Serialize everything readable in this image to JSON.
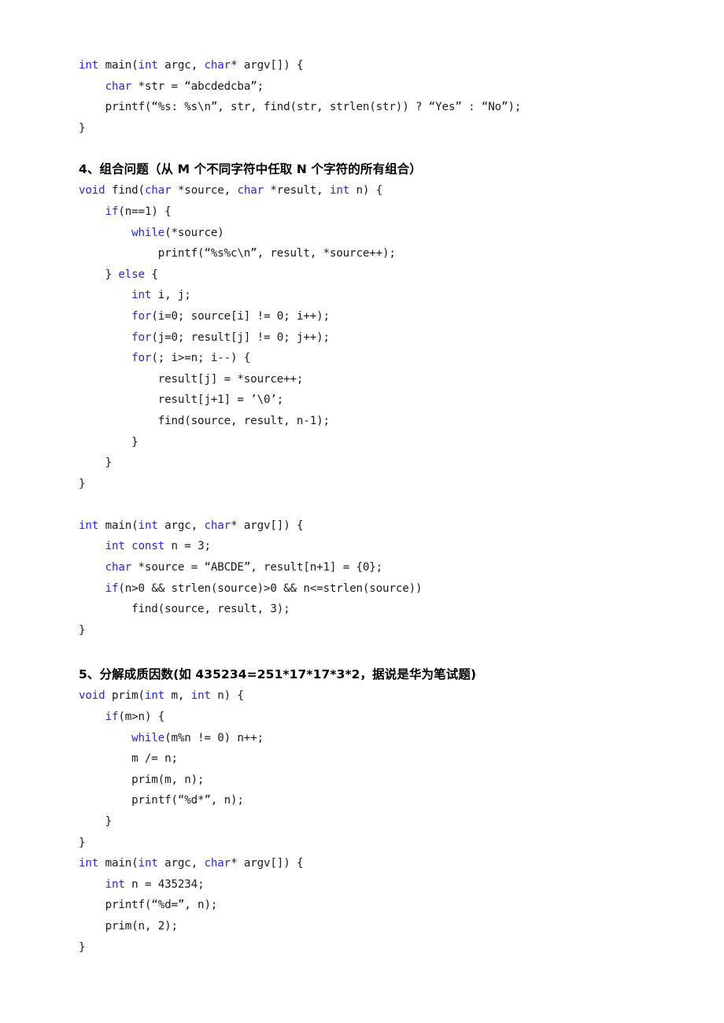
{
  "document": {
    "language": "zh-CN",
    "colors": {
      "page_background": "#ffffff",
      "body_text": "#1a1a1a",
      "keyword_blue": "#2a2ac4",
      "heading_text": "#000000"
    },
    "sections": [
      {
        "id": "section-3-tail",
        "heading": null,
        "code_lines": [
          [
            {
              "t": "int",
              "c": "kw"
            },
            {
              "t": " main(",
              "c": "plain"
            },
            {
              "t": "int",
              "c": "kw"
            },
            {
              "t": " argc, ",
              "c": "plain"
            },
            {
              "t": "char",
              "c": "kw"
            },
            {
              "t": "* argv[]) {",
              "c": "plain"
            }
          ],
          [
            {
              "t": "    ",
              "c": "plain"
            },
            {
              "t": "char",
              "c": "kw"
            },
            {
              "t": " *str = “abcdedcba”;",
              "c": "plain"
            }
          ],
          [
            {
              "t": "    printf(“%s: %s\\n”, str, find(str, strlen(str)) ? “Yes” : “No”);",
              "c": "plain"
            }
          ],
          [
            {
              "t": "}",
              "c": "plain"
            }
          ]
        ]
      },
      {
        "id": "section-4",
        "heading": "4、组合问题（从 M 个不同字符中任取 N 个字符的所有组合）",
        "code_lines": [
          [
            {
              "t": "void",
              "c": "kw"
            },
            {
              "t": " find(",
              "c": "plain"
            },
            {
              "t": "char",
              "c": "kw"
            },
            {
              "t": " *source, ",
              "c": "plain"
            },
            {
              "t": "char",
              "c": "kw"
            },
            {
              "t": " *result, ",
              "c": "plain"
            },
            {
              "t": "int",
              "c": "kw"
            },
            {
              "t": " n) {",
              "c": "plain"
            }
          ],
          [
            {
              "t": "    ",
              "c": "plain"
            },
            {
              "t": "if",
              "c": "kw"
            },
            {
              "t": "(n==1) {",
              "c": "plain"
            }
          ],
          [
            {
              "t": "        ",
              "c": "plain"
            },
            {
              "t": "while",
              "c": "kw"
            },
            {
              "t": "(*source)",
              "c": "plain"
            }
          ],
          [
            {
              "t": "            printf(“%s%c\\n”, result, *source++);",
              "c": "plain"
            }
          ],
          [
            {
              "t": "    } ",
              "c": "plain"
            },
            {
              "t": "else",
              "c": "kw"
            },
            {
              "t": " {",
              "c": "plain"
            }
          ],
          [
            {
              "t": "        ",
              "c": "plain"
            },
            {
              "t": "int",
              "c": "kw"
            },
            {
              "t": " i, j;",
              "c": "plain"
            }
          ],
          [
            {
              "t": "        ",
              "c": "plain"
            },
            {
              "t": "for",
              "c": "kw"
            },
            {
              "t": "(i=0; source[i] != 0; i++);",
              "c": "plain"
            }
          ],
          [
            {
              "t": "        ",
              "c": "plain"
            },
            {
              "t": "for",
              "c": "kw"
            },
            {
              "t": "(j=0; result[j] != 0; j++);",
              "c": "plain"
            }
          ],
          [
            {
              "t": "        ",
              "c": "plain"
            },
            {
              "t": "for",
              "c": "kw"
            },
            {
              "t": "(; i>=n; i--) {",
              "c": "plain"
            }
          ],
          [
            {
              "t": "            result[j] = *source++;",
              "c": "plain"
            }
          ],
          [
            {
              "t": "            result[j+1] = ’\\0’;",
              "c": "plain"
            }
          ],
          [
            {
              "t": "            find(source, result, n-1);",
              "c": "plain"
            }
          ],
          [
            {
              "t": "        }",
              "c": "plain"
            }
          ],
          [
            {
              "t": "    }",
              "c": "plain"
            }
          ],
          [
            {
              "t": "}",
              "c": "plain"
            }
          ],
          [
            {
              "t": "",
              "c": "plain"
            }
          ],
          [
            {
              "t": "int",
              "c": "kw"
            },
            {
              "t": " main(",
              "c": "plain"
            },
            {
              "t": "int",
              "c": "kw"
            },
            {
              "t": " argc, ",
              "c": "plain"
            },
            {
              "t": "char",
              "c": "kw"
            },
            {
              "t": "* argv[]) {",
              "c": "plain"
            }
          ],
          [
            {
              "t": "    ",
              "c": "plain"
            },
            {
              "t": "int const",
              "c": "kw"
            },
            {
              "t": " n = 3;",
              "c": "plain"
            }
          ],
          [
            {
              "t": "    ",
              "c": "plain"
            },
            {
              "t": "char",
              "c": "kw"
            },
            {
              "t": " *source = “ABCDE”, result[n+1] = {0};",
              "c": "plain"
            }
          ],
          [
            {
              "t": "    ",
              "c": "plain"
            },
            {
              "t": "if",
              "c": "kw"
            },
            {
              "t": "(n>0 && strlen(source)>0 && n<=strlen(source))",
              "c": "plain"
            }
          ],
          [
            {
              "t": "        find(source, result, 3);",
              "c": "plain"
            }
          ],
          [
            {
              "t": "}",
              "c": "plain"
            }
          ]
        ]
      },
      {
        "id": "section-5",
        "heading": "5、分解成质因数(如 435234=251*17*17*3*2，据说是华为笔试题)",
        "code_lines": [
          [
            {
              "t": "void",
              "c": "kw"
            },
            {
              "t": " prim(",
              "c": "plain"
            },
            {
              "t": "int",
              "c": "kw"
            },
            {
              "t": " m, ",
              "c": "plain"
            },
            {
              "t": "int",
              "c": "kw"
            },
            {
              "t": " n) {",
              "c": "plain"
            }
          ],
          [
            {
              "t": "    ",
              "c": "plain"
            },
            {
              "t": "if",
              "c": "kw"
            },
            {
              "t": "(m>n) {",
              "c": "plain"
            }
          ],
          [
            {
              "t": "        ",
              "c": "plain"
            },
            {
              "t": "while",
              "c": "kw"
            },
            {
              "t": "(m%n != 0) n++;",
              "c": "plain"
            }
          ],
          [
            {
              "t": "        m /= n;",
              "c": "plain"
            }
          ],
          [
            {
              "t": "        prim(m, n);",
              "c": "plain"
            }
          ],
          [
            {
              "t": "        printf(“%d*”, n);",
              "c": "plain"
            }
          ],
          [
            {
              "t": "    }",
              "c": "plain"
            }
          ],
          [
            {
              "t": "}",
              "c": "plain"
            }
          ],
          [
            {
              "t": "int",
              "c": "kw"
            },
            {
              "t": " main(",
              "c": "plain"
            },
            {
              "t": "int",
              "c": "kw"
            },
            {
              "t": " argc, ",
              "c": "plain"
            },
            {
              "t": "char",
              "c": "kw"
            },
            {
              "t": "* argv[]) {",
              "c": "plain"
            }
          ],
          [
            {
              "t": "    ",
              "c": "plain"
            },
            {
              "t": "int",
              "c": "kw"
            },
            {
              "t": " n = 435234;",
              "c": "plain"
            }
          ],
          [
            {
              "t": "    printf(“%d=”, n);",
              "c": "plain"
            }
          ],
          [
            {
              "t": "    prim(n, 2);",
              "c": "plain"
            }
          ],
          [
            {
              "t": "}",
              "c": "plain"
            }
          ]
        ]
      }
    ]
  }
}
